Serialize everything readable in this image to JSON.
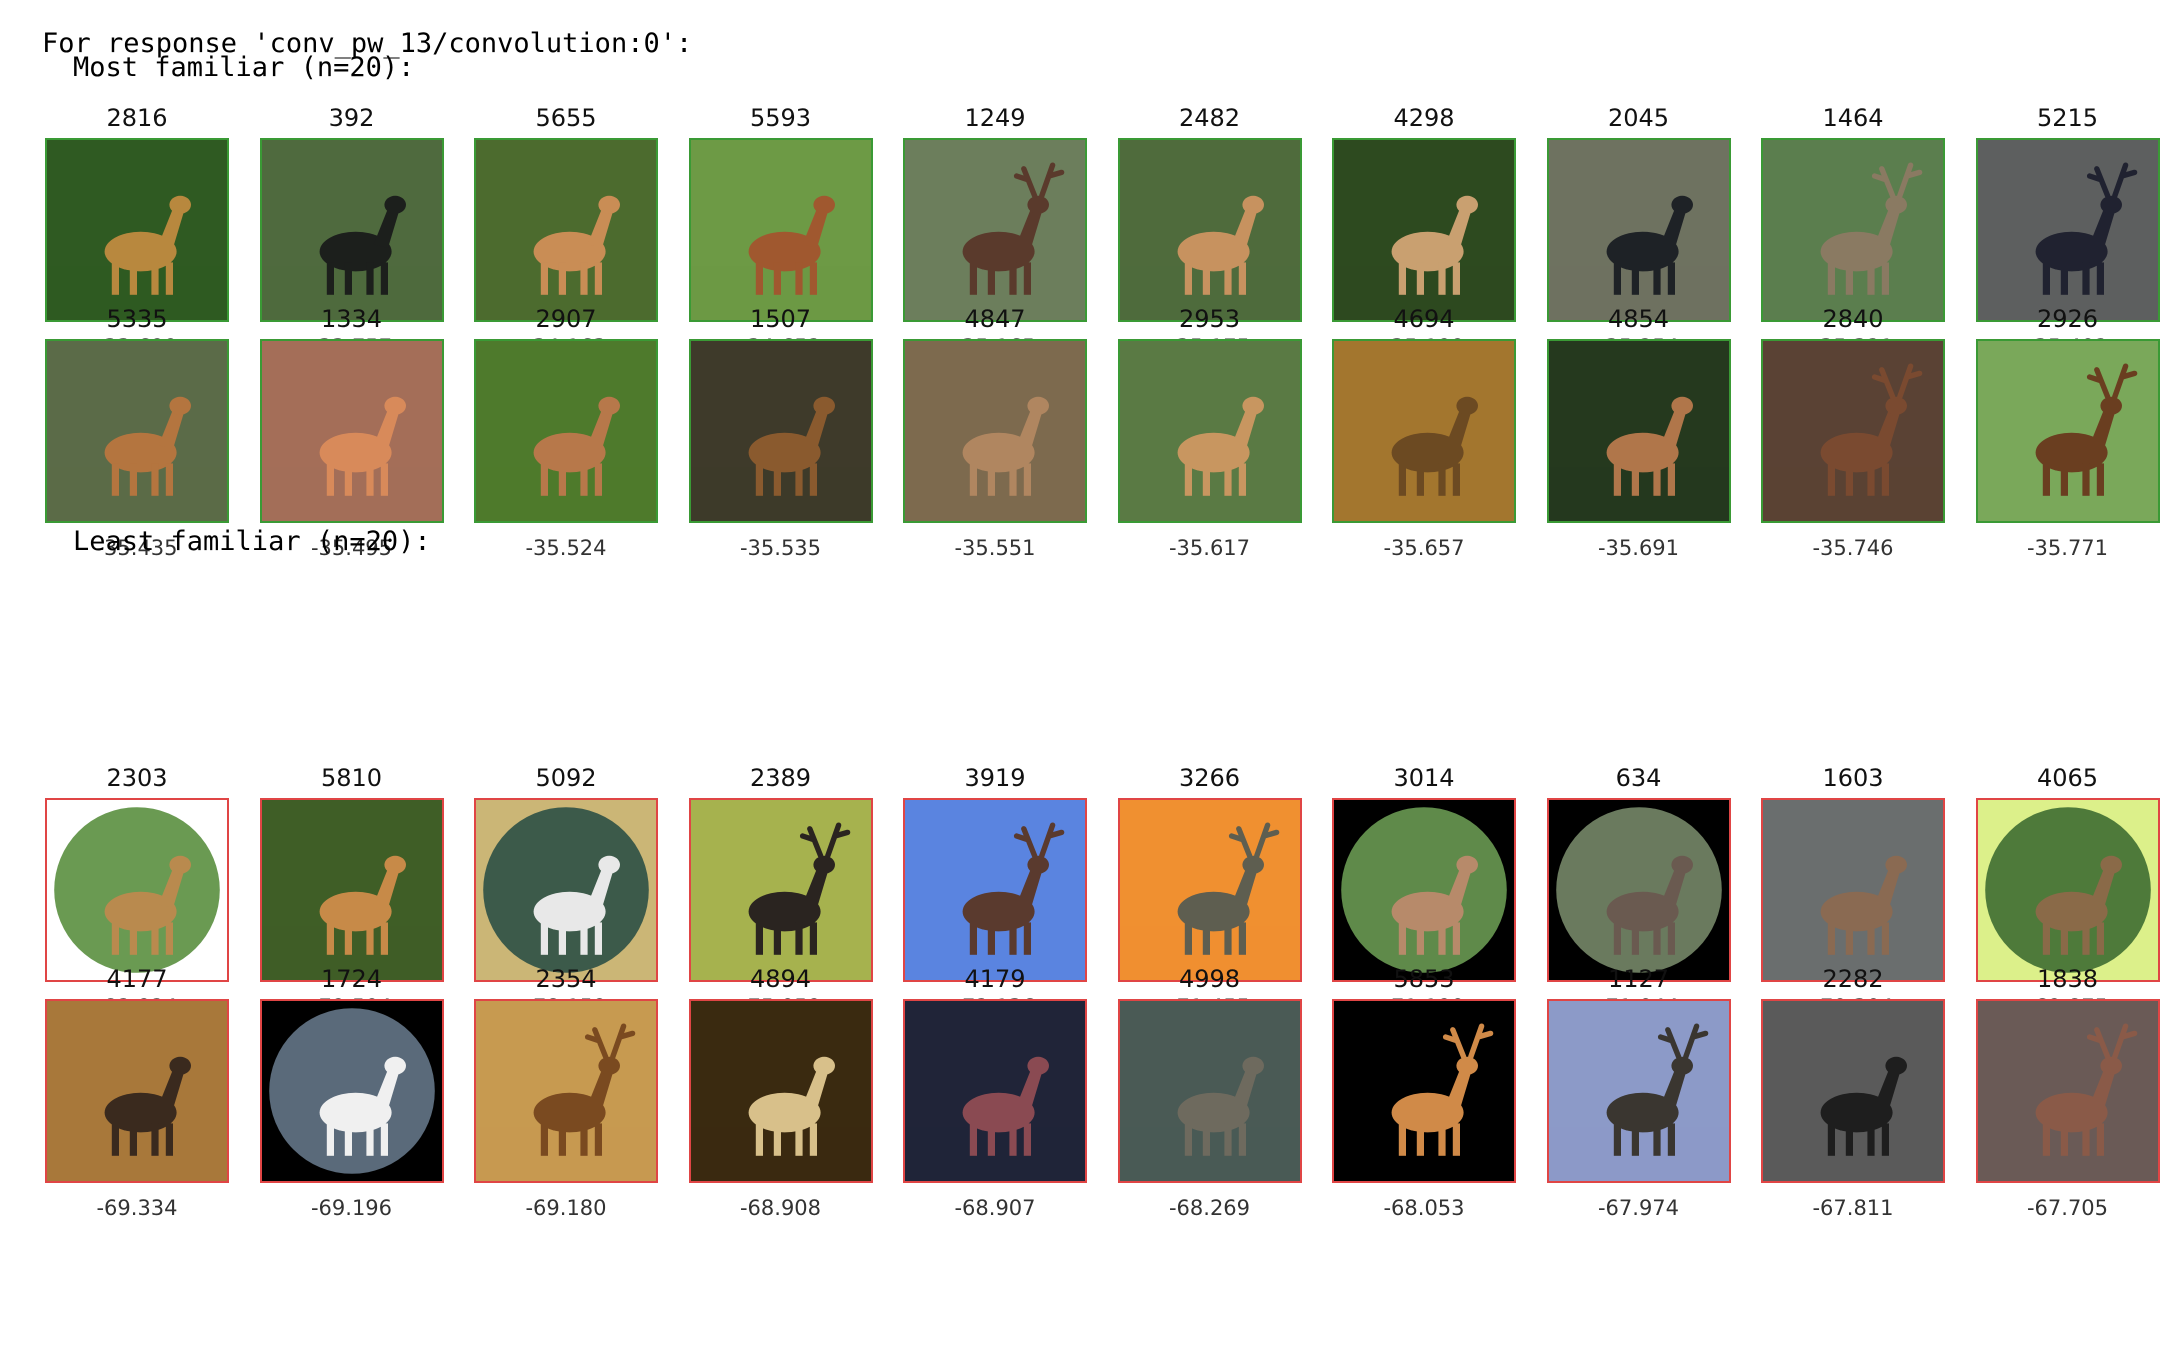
{
  "header": "For response 'conv_pw_13/convolution:0':",
  "sections": [
    {
      "kind": "most",
      "title": "Most familiar (n=20):",
      "rows": [
        [
          {
            "index": "2816",
            "score": "-33.699",
            "bg": "#2f5a22",
            "fg": "#b8883e",
            "shape": "deer"
          },
          {
            "index": "392",
            "score": "-33.757",
            "bg": "#4f6a3e",
            "fg": "#1c1f1c",
            "shape": "deer"
          },
          {
            "index": "5655",
            "score": "-34.163",
            "bg": "#4c6b2e",
            "fg": "#c98d55",
            "shape": "deer"
          },
          {
            "index": "5593",
            "score": "-34.652",
            "bg": "#6d9a45",
            "fg": "#a0582f",
            "shape": "deer"
          },
          {
            "index": "1249",
            "score": "-35.165",
            "bg": "#6c7e5c",
            "fg": "#5a3a2c",
            "shape": "stag"
          },
          {
            "index": "2482",
            "score": "-35.175",
            "bg": "#4f6b3c",
            "fg": "#c7925f",
            "shape": "deer"
          },
          {
            "index": "4298",
            "score": "-35.199",
            "bg": "#2d4a1f",
            "fg": "#c9a070",
            "shape": "deer"
          },
          {
            "index": "2045",
            "score": "-35.254",
            "bg": "#6e7260",
            "fg": "#1e2226",
            "shape": "deer"
          },
          {
            "index": "1464",
            "score": "-35.321",
            "bg": "#5b7e4e",
            "fg": "#8a7a62",
            "shape": "stag"
          },
          {
            "index": "5215",
            "score": "-35.402",
            "bg": "#5d5f5f",
            "fg": "#202230",
            "shape": "stag"
          }
        ],
        [
          {
            "index": "5335",
            "score": "-35.435",
            "bg": "#5b6b48",
            "fg": "#b4753f",
            "shape": "deer"
          },
          {
            "index": "1334",
            "score": "-35.495",
            "bg": "#a46e58",
            "fg": "#d88a5a",
            "shape": "deer"
          },
          {
            "index": "2907",
            "score": "-35.524",
            "bg": "#4e7a2c",
            "fg": "#b7784a",
            "shape": "deer"
          },
          {
            "index": "1507",
            "score": "-35.535",
            "bg": "#3e3a2a",
            "fg": "#8a5a2e",
            "shape": "deer"
          },
          {
            "index": "4847",
            "score": "-35.551",
            "bg": "#7d6a4e",
            "fg": "#b08660",
            "shape": "deer"
          },
          {
            "index": "2953",
            "score": "-35.617",
            "bg": "#5a7a44",
            "fg": "#c89660",
            "shape": "deer"
          },
          {
            "index": "4694",
            "score": "-35.657",
            "bg": "#a3762e",
            "fg": "#6c4a22",
            "shape": "deer"
          },
          {
            "index": "4854",
            "score": "-35.691",
            "bg": "#25391e",
            "fg": "#b0764a",
            "shape": "deer"
          },
          {
            "index": "2840",
            "score": "-35.746",
            "bg": "#5a4234",
            "fg": "#7a4a30",
            "shape": "stag"
          },
          {
            "index": "2926",
            "score": "-35.771",
            "bg": "#7aa85a",
            "fg": "#6a3e20",
            "shape": "stag"
          }
        ]
      ]
    },
    {
      "kind": "least",
      "title": "Least familiar (n=20):",
      "rows": [
        [
          {
            "index": "2303",
            "score": "-82.924",
            "bg": "#ffffff",
            "fg": "#b98a4e",
            "shape": "circle",
            "inner": "#6a9a52"
          },
          {
            "index": "5810",
            "score": "-79.504",
            "bg": "#3f5e26",
            "fg": "#c78a48",
            "shape": "deer"
          },
          {
            "index": "5092",
            "score": "-78.159",
            "bg": "#cbb676",
            "fg": "#e8e8e8",
            "shape": "circle",
            "inner": "#3c5a4a"
          },
          {
            "index": "2389",
            "score": "-75.059",
            "bg": "#a6b24e",
            "fg": "#2a2420",
            "shape": "stag"
          },
          {
            "index": "3919",
            "score": "-72.136",
            "bg": "#5a84e0",
            "fg": "#5a3a2e",
            "shape": "stag"
          },
          {
            "index": "3266",
            "score": "-71.455",
            "bg": "#f09030",
            "fg": "#5e5e50",
            "shape": "stag"
          },
          {
            "index": "3014",
            "score": "-71.190",
            "bg": "#000000",
            "fg": "#b78a6a",
            "shape": "circle",
            "inner": "#5f8a4a"
          },
          {
            "index": "634",
            "score": "-71.044",
            "bg": "#000000",
            "fg": "#6a5a50",
            "shape": "circle",
            "inner": "#6a7a5e"
          },
          {
            "index": "1603",
            "score": "-70.304",
            "bg": "#6a6e6e",
            "fg": "#8a6a52",
            "shape": "deer"
          },
          {
            "index": "4065",
            "score": "-69.875",
            "bg": "#dcf08a",
            "fg": "#8a6a48",
            "shape": "circle",
            "inner": "#4e7a3a"
          }
        ],
        [
          {
            "index": "4177",
            "score": "-69.334",
            "bg": "#a8783a",
            "fg": "#3a2a1e",
            "shape": "deer"
          },
          {
            "index": "1724",
            "score": "-69.196",
            "bg": "#000000",
            "fg": "#f0f0f0",
            "shape": "circle",
            "inner": "#5a6a7a"
          },
          {
            "index": "2354",
            "score": "-69.180",
            "bg": "#c79a50",
            "fg": "#7a4a20",
            "shape": "stag"
          },
          {
            "index": "4894",
            "score": "-68.908",
            "bg": "#3a2a10",
            "fg": "#d8c08a",
            "shape": "deer"
          },
          {
            "index": "4179",
            "score": "-68.907",
            "bg": "#202438",
            "fg": "#8a4a52",
            "shape": "deer"
          },
          {
            "index": "4998",
            "score": "-68.269",
            "bg": "#4a5a55",
            "fg": "#6e6a5e",
            "shape": "deer"
          },
          {
            "index": "5853",
            "score": "-68.053",
            "bg": "#000000",
            "fg": "#d08a48",
            "shape": "stag"
          },
          {
            "index": "1127",
            "score": "-67.974",
            "bg": "#8c9ac8",
            "fg": "#3a3630",
            "shape": "stag"
          },
          {
            "index": "2282",
            "score": "-67.811",
            "bg": "#5a5a5a",
            "fg": "#1e1e1e",
            "shape": "deer"
          },
          {
            "index": "1838",
            "score": "-67.705",
            "bg": "#6a5a56",
            "fg": "#8a5a48",
            "shape": "stag"
          }
        ]
      ]
    }
  ]
}
